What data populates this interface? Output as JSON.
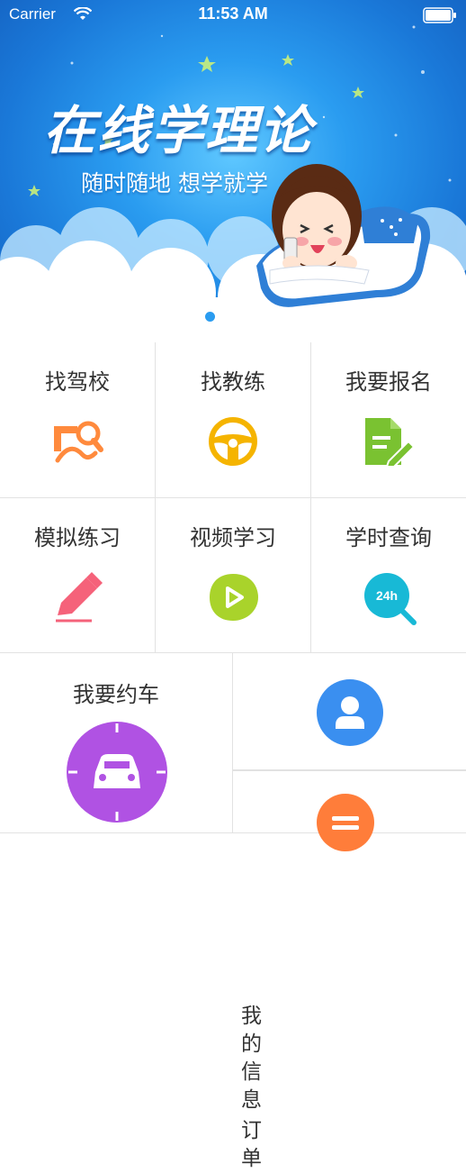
{
  "status_bar": {
    "carrier": "Carrier",
    "time": "11:53 AM"
  },
  "banner": {
    "title": "在线学理论",
    "subtitle": "随时随地 想学就学",
    "page_indicator": {
      "current": 1
    }
  },
  "grid": {
    "row1": [
      {
        "label": "找驾校",
        "icon": "find-school-icon",
        "color": "#ff8a3d"
      },
      {
        "label": "找教练",
        "icon": "steering-wheel-icon",
        "color": "#f5b400"
      },
      {
        "label": "我要报名",
        "icon": "signup-form-icon",
        "color": "#7ac231"
      }
    ],
    "row2": [
      {
        "label": "模拟练习",
        "icon": "pencil-icon",
        "color": "#f5627a"
      },
      {
        "label": "视频学习",
        "icon": "video-play-icon",
        "color": "#a9d32b"
      },
      {
        "label": "学时查询",
        "icon": "24h-query-icon",
        "color": "#18b9d6",
        "icon_text": "24h"
      }
    ],
    "book_car": {
      "label": "我要约车",
      "icon": "car-icon",
      "color": "#b052e3"
    },
    "my_info": {
      "label": "我的信息",
      "icon": "user-icon",
      "color": "#3a8ff0"
    },
    "orders": {
      "label": "订单",
      "icon": "list-icon",
      "color": "#ff7d3a"
    }
  }
}
